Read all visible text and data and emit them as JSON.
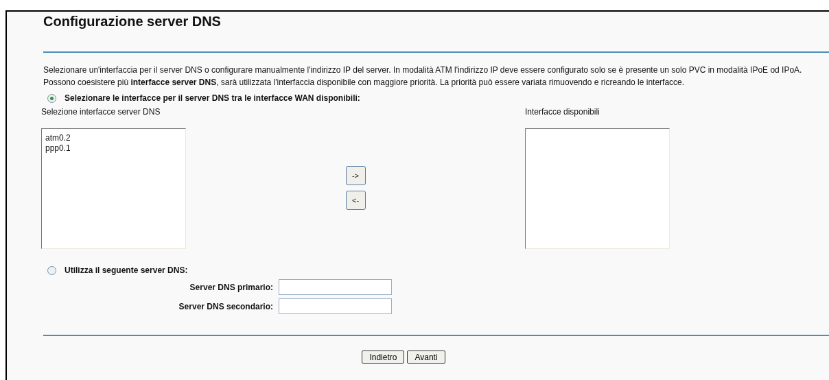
{
  "title": "Configurazione server DNS",
  "description": [
    "Selezionare un'interfaccia per il server DNS o configurare manualmente l'indirizzo IP del server. In modalità ATM l'indirizzo IP deve essere configurato solo se è presente un solo PVC in modalità IPoE od IPoA.",
    "Possono coesistere più **interfacce server DNS**, sarà utilizzata l'interfaccia disponibile con maggiore priorità. La priorità può essere variata rimuovendo e ricreando le interfacce."
  ],
  "options": [
    {
      "label": "Selezionare le interfacce per il server DNS tra le interfacce WAN disponibili:",
      "selected": true
    },
    {
      "label": "Utilizza il seguente server DNS:",
      "selected": false
    }
  ],
  "selected_list": {
    "label": "Selezione interfacce server DNS",
    "items": [
      "atm0.2",
      "ppp0.1"
    ]
  },
  "move_buttons": [
    "->",
    "<-"
  ],
  "available_list": {
    "label": "Interfacce disponibili"
  },
  "fields": [
    {
      "label": "Server DNS primario:"
    },
    {
      "label": "Server DNS secondario:"
    }
  ],
  "buttons": [
    "Indietro",
    "Avanti"
  ]
}
